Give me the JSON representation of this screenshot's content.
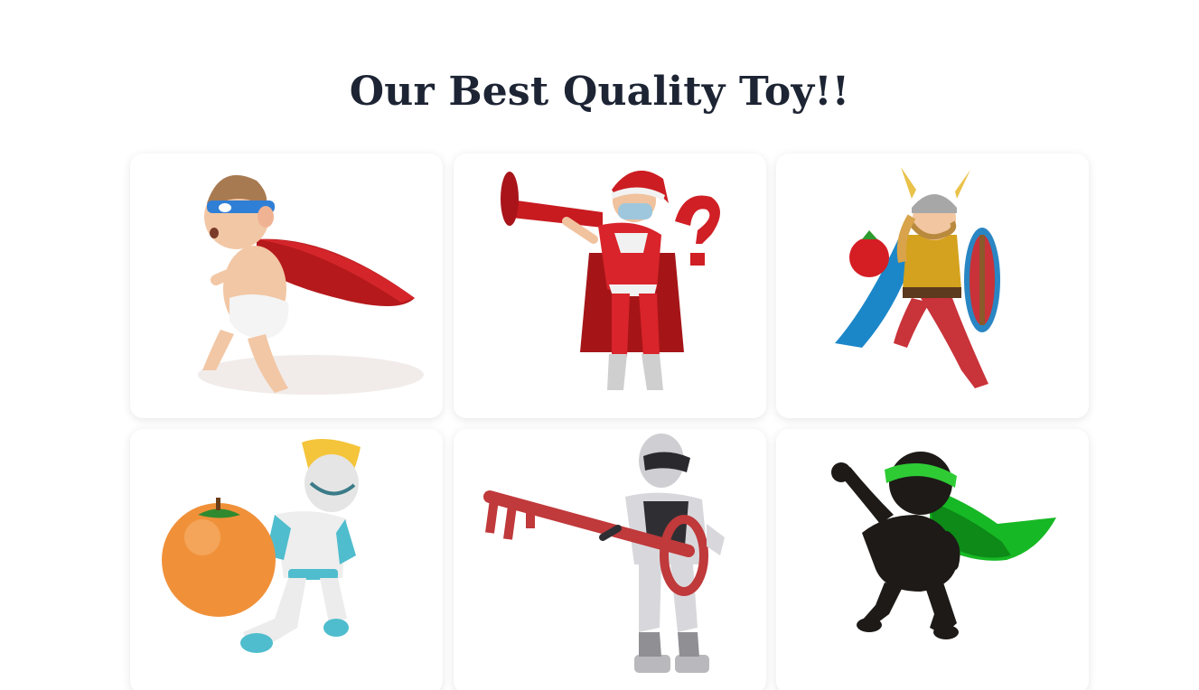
{
  "page": {
    "title": "Our Best Quality Toy!!"
  },
  "products": [
    {
      "name": "caped-baby-toy"
    },
    {
      "name": "santa-superhero-toy"
    },
    {
      "name": "viking-warrior-toy"
    },
    {
      "name": "robot-with-orange-toy"
    },
    {
      "name": "robot-with-key-toy"
    },
    {
      "name": "green-caped-hero-toy"
    }
  ],
  "colors": {
    "title": "#1d2433",
    "card_background": "#ffffff"
  }
}
